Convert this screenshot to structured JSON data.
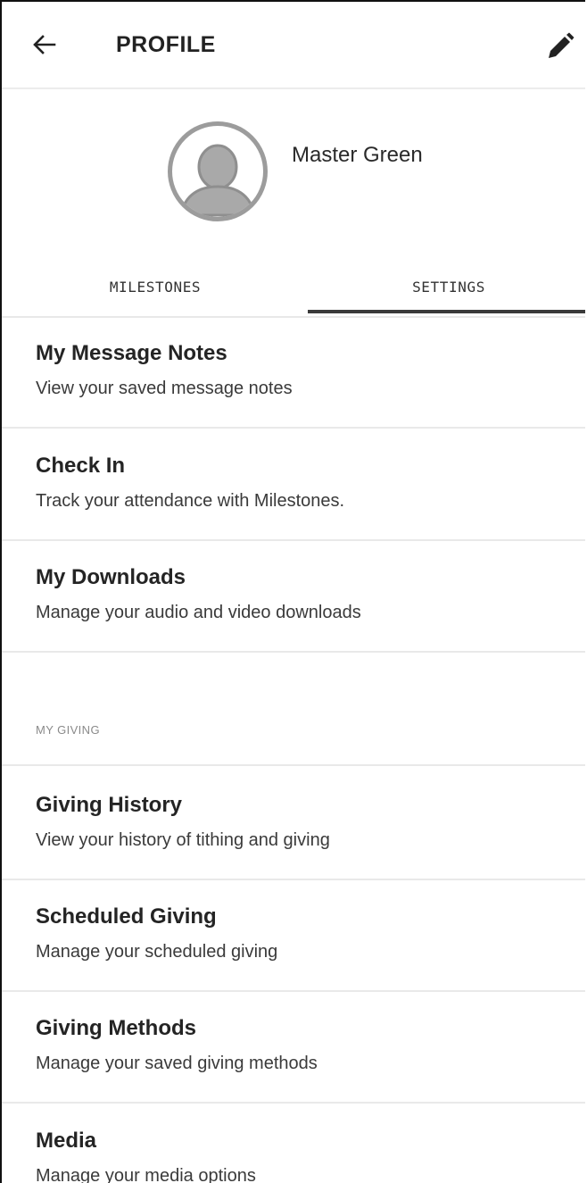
{
  "header": {
    "title": "PROFILE",
    "back_icon": "arrow-left-icon",
    "edit_icon": "pencil-icon"
  },
  "profile": {
    "name": "Master Green",
    "avatar_icon": "person-placeholder-icon"
  },
  "tabs": [
    {
      "label": "MILESTONES",
      "active": false
    },
    {
      "label": "SETTINGS",
      "active": true
    }
  ],
  "items": [
    {
      "title": "My Message Notes",
      "subtitle": "View your saved message notes"
    },
    {
      "title": "Check In",
      "subtitle": "Track your attendance with Milestones."
    },
    {
      "title": "My Downloads",
      "subtitle": "Manage your audio and video downloads"
    }
  ],
  "section": {
    "label": "MY GIVING"
  },
  "giving_items": [
    {
      "title": "Giving History",
      "subtitle": "View your history of tithing and giving"
    },
    {
      "title": "Scheduled Giving",
      "subtitle": "Manage your scheduled giving"
    },
    {
      "title": "Giving Methods",
      "subtitle": "Manage your saved giving methods"
    },
    {
      "title": "Media",
      "subtitle": "Manage your media options"
    }
  ],
  "colors": {
    "text": "#222222",
    "divider": "#e9e9e9",
    "avatar": "#9c9c9c",
    "tab_indicator": "#3a3a3a"
  }
}
